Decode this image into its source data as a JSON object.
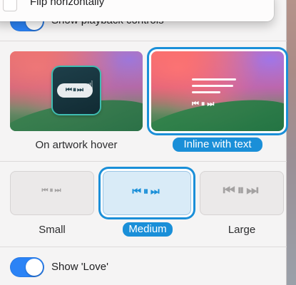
{
  "menu": {
    "item_label": "Flip horizontally",
    "checked": false
  },
  "playback": {
    "label": "Show playback controls",
    "enabled": true
  },
  "position": {
    "options": [
      {
        "label": "On artwork hover",
        "selected": false,
        "preview_glyph": "⏮⏸⏭"
      },
      {
        "label": "Inline with text",
        "selected": true,
        "preview_glyph": "⏮⏸⏭"
      }
    ]
  },
  "size": {
    "options": [
      {
        "label": "Small",
        "selected": false,
        "glyph": "⏮⏸⏭"
      },
      {
        "label": "Medium",
        "selected": true,
        "glyph": "⏮⏸⏭"
      },
      {
        "label": "Large",
        "selected": false,
        "glyph": "⏮⏸⏭"
      }
    ]
  },
  "love": {
    "label": "Show 'Love'",
    "enabled": true
  },
  "colors": {
    "accent": "#1a8fd8",
    "toggle_on": "#2b83f6",
    "panel_bg": "#f5f4f4"
  }
}
